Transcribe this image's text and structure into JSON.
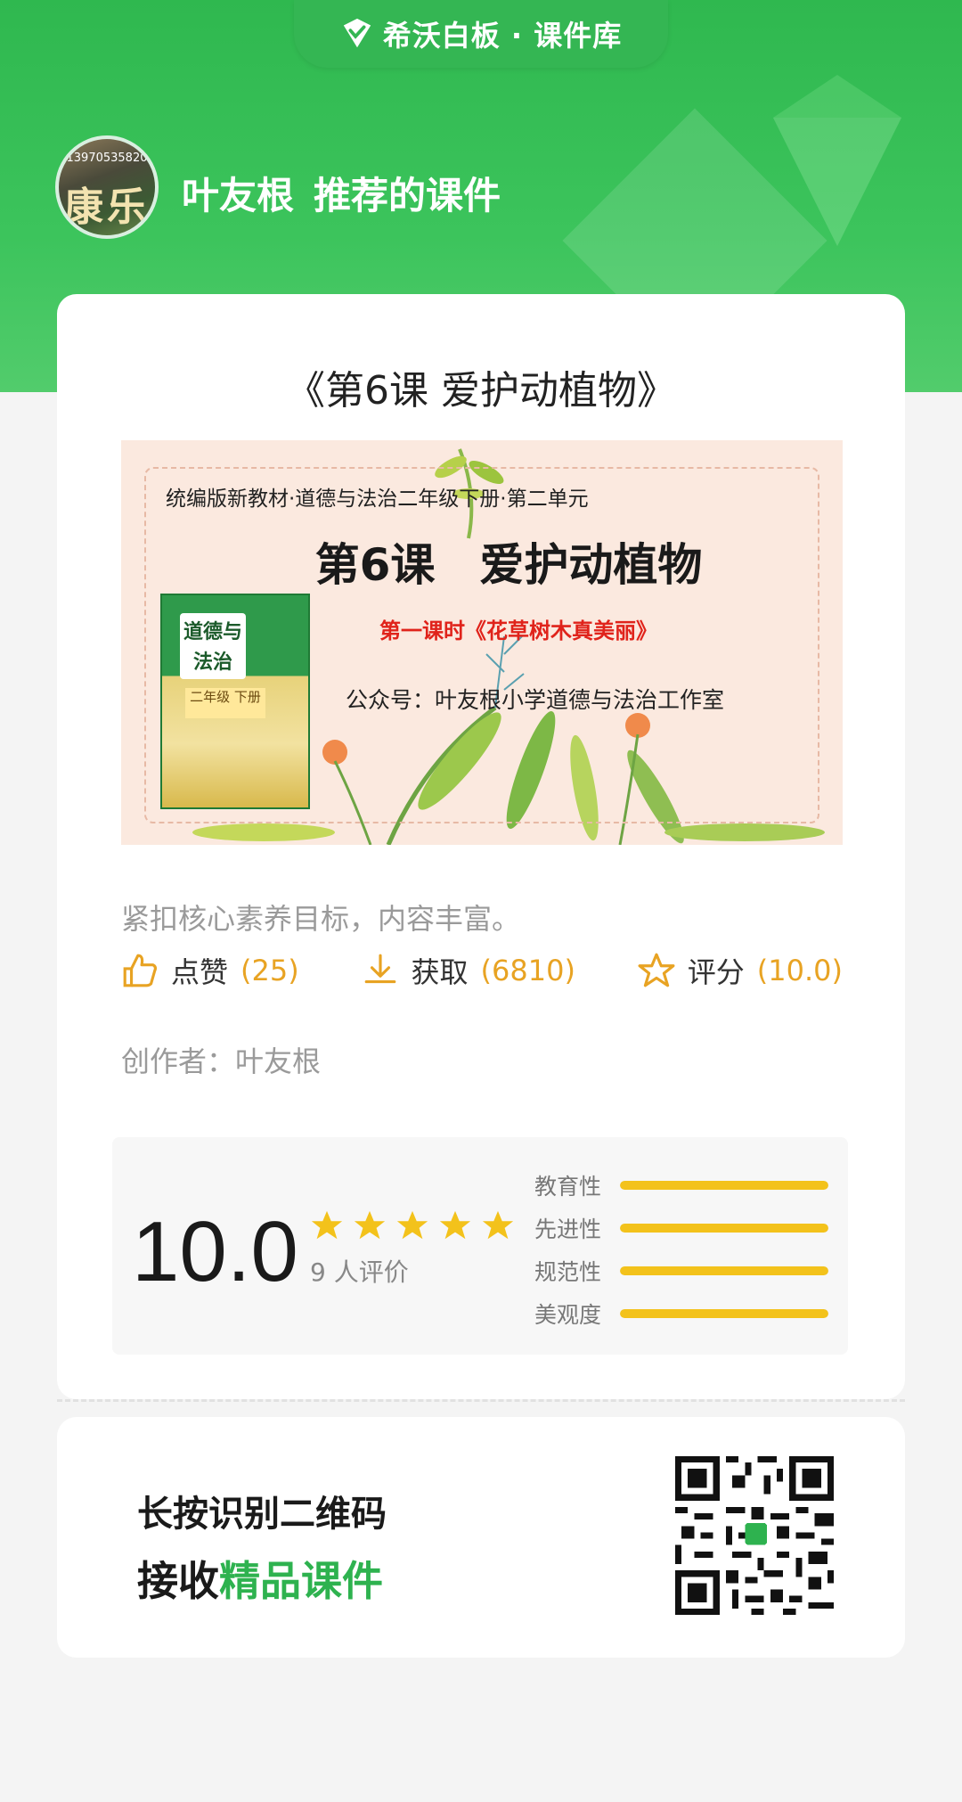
{
  "header": {
    "brand": "希沃白板 · 课件库",
    "avatar_phone": "13970535820",
    "avatar_chars": "康乐",
    "recommender_name": "叶友根",
    "recommender_suffix": "推荐的课件"
  },
  "course": {
    "title": "《第6课 爱护动植物》",
    "cover": {
      "subtitle": "统编版新教材·道德与法治二年级下册·第二单元",
      "lesson": "第6课　爱护动植物",
      "period": "第一课时《花草树木真美丽》",
      "account": "公众号：叶友根小学道德与法治工作室",
      "book_title": "道德与法治",
      "book_grade": "二年级 下册"
    },
    "description": "紧扣核心素养目标，内容丰富。",
    "stats": {
      "like_label": "点赞",
      "like_count": "(25)",
      "get_label": "获取",
      "get_count": "(6810)",
      "score_label": "评分",
      "score_value": "(10.0)"
    },
    "author_prefix": "创作者：",
    "author_name": "叶友根"
  },
  "rating": {
    "score": "10.0",
    "stars": 5,
    "count_label": "9 人评价",
    "dimensions": [
      {
        "label": "教育性",
        "value": 1.0
      },
      {
        "label": "先进性",
        "value": 1.0
      },
      {
        "label": "规范性",
        "value": 1.0
      },
      {
        "label": "美观度",
        "value": 1.0
      }
    ]
  },
  "qr": {
    "line1": "长按识别二维码",
    "line2_prefix": "接收",
    "line2_accent": "精品课件"
  },
  "colors": {
    "brand_green": "#2fb84f",
    "accent_orange": "#e8a323",
    "star_yellow": "#f3c21b",
    "accent_green_text": "#2eb24f"
  }
}
